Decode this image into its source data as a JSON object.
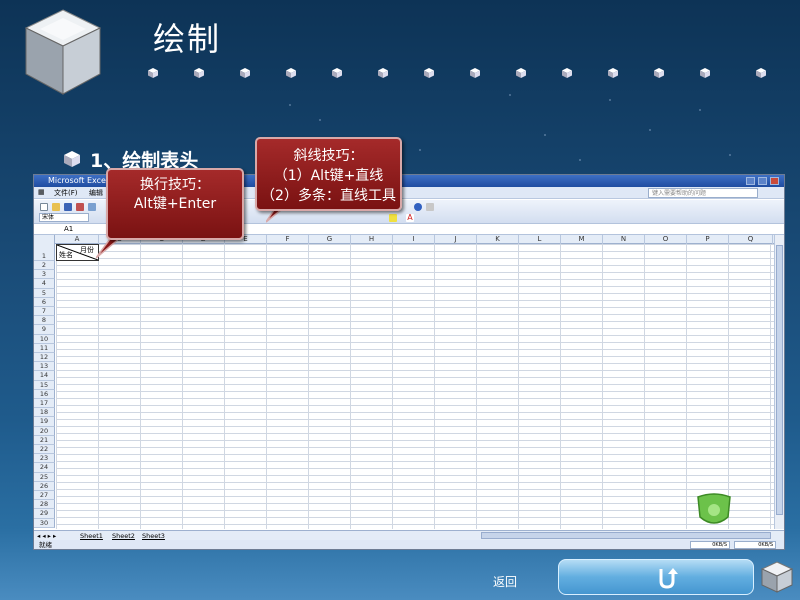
{
  "header": {
    "title": "绘制"
  },
  "section": {
    "title": "1、绘制表头"
  },
  "callouts": {
    "wrap_tip": {
      "line1": "换行技巧：",
      "line2": "Alt键+Enter"
    },
    "diagonal_tip": {
      "line1": "斜线技巧：",
      "line2": "（1）Alt键+直线",
      "line3": "（2）多条：直线工具"
    }
  },
  "excel": {
    "window_title": "Microsoft Excel",
    "menu": {
      "file": "文件(F)",
      "edit": "编辑",
      "help_box": "键入需要帮助的问题"
    },
    "font_name": "宋体",
    "name_box": "A1",
    "columns": [
      "A",
      "B",
      "C",
      "D",
      "E",
      "F",
      "G",
      "H",
      "I",
      "J",
      "K",
      "L",
      "M",
      "N",
      "O",
      "P",
      "Q"
    ],
    "rows": [
      "1",
      "2",
      "3",
      "4",
      "5",
      "6",
      "7",
      "8",
      "9",
      "10",
      "11",
      "12",
      "13",
      "14",
      "15",
      "16",
      "17",
      "18",
      "19",
      "20",
      "21",
      "22",
      "23",
      "24",
      "25",
      "26",
      "27",
      "28",
      "29",
      "30"
    ],
    "cell_a1": {
      "top": "月份",
      "bottom": "姓名"
    },
    "sheets": [
      "Sheet1",
      "Sheet2",
      "Sheet3"
    ],
    "status": "就绪",
    "speed1": "0KB/S",
    "speed2": "0KB/S"
  },
  "footer": {
    "back_label": "返回"
  }
}
